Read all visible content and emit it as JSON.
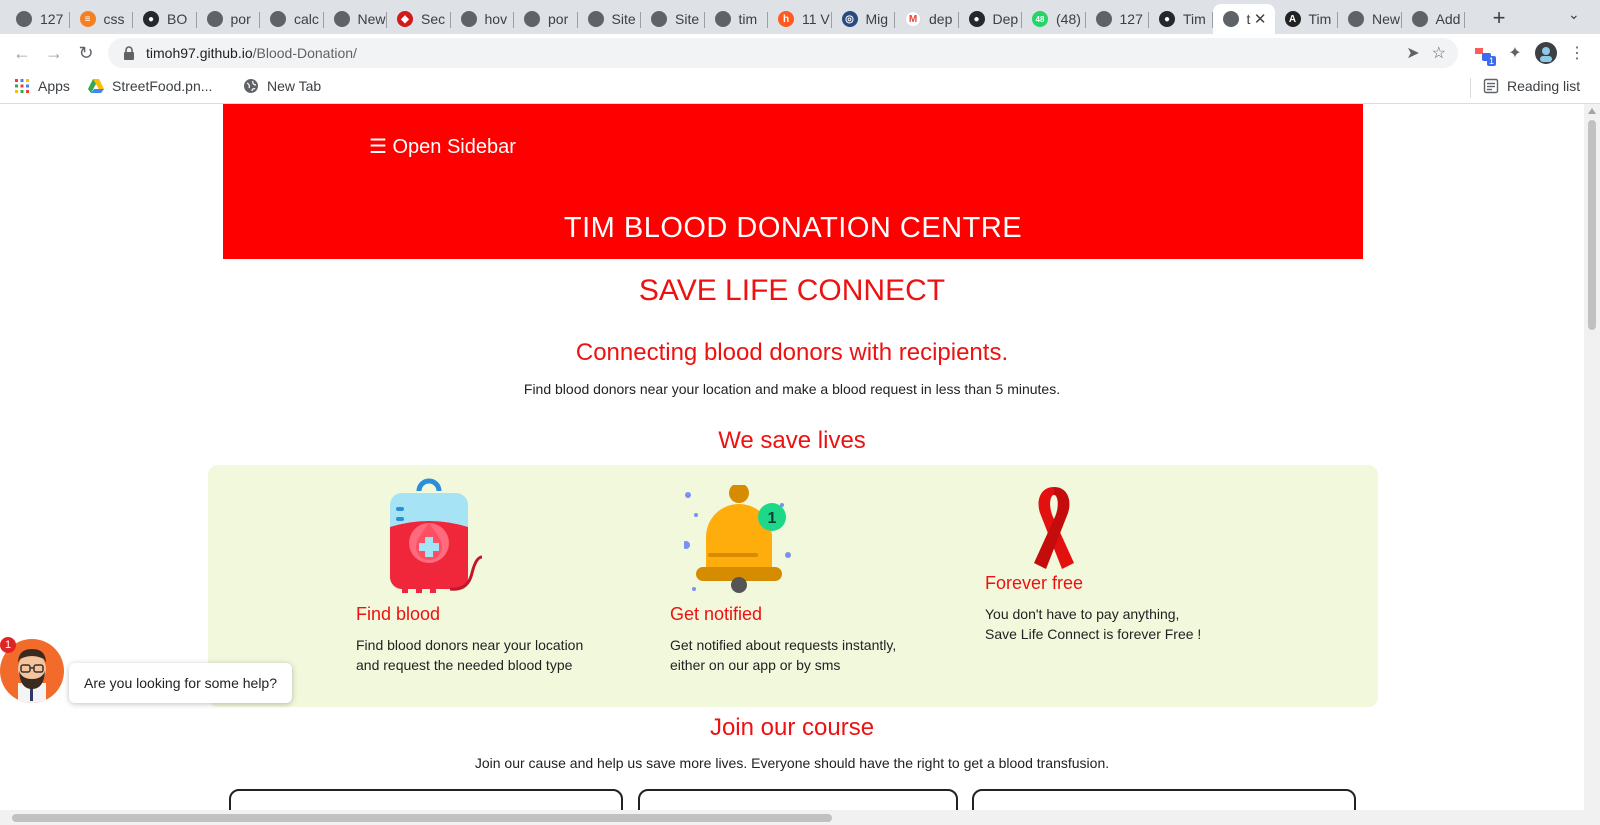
{
  "browser": {
    "tabs": [
      {
        "label": "127",
        "icon": "globe-icon"
      },
      {
        "label": "css",
        "icon": "stackoverflow-icon"
      },
      {
        "label": "BO",
        "icon": "github-icon"
      },
      {
        "label": "por",
        "icon": "globe-icon"
      },
      {
        "label": "calc",
        "icon": "globe-icon"
      },
      {
        "label": "New",
        "icon": "globe-icon"
      },
      {
        "label": "Sec",
        "icon": "red-diamond-icon"
      },
      {
        "label": "hov",
        "icon": "globe-icon"
      },
      {
        "label": "por",
        "icon": "globe-icon"
      },
      {
        "label": "Site",
        "icon": "globe-icon"
      },
      {
        "label": "Site",
        "icon": "globe-icon"
      },
      {
        "label": "tim",
        "icon": "globe-icon"
      },
      {
        "label": "11 V",
        "icon": "orange-box-icon"
      },
      {
        "label": "Mig",
        "icon": "circle-logo-icon"
      },
      {
        "label": "dep",
        "icon": "gmail-icon"
      },
      {
        "label": "Dep",
        "icon": "github-icon"
      },
      {
        "label": "(48)",
        "icon": "green-badge-icon"
      },
      {
        "label": "127",
        "icon": "globe-icon"
      },
      {
        "label": "Tim",
        "icon": "github-icon"
      },
      {
        "label": "t",
        "icon": "globe-icon",
        "active": true
      },
      {
        "label": "Tim",
        "icon": "angular-icon"
      },
      {
        "label": "New",
        "icon": "globe-icon"
      },
      {
        "label": "Add",
        "icon": "globe-icon"
      }
    ],
    "url_host": "timoh97.github.io",
    "url_path": "/Blood-Donation/",
    "bookmarks": {
      "apps": "Apps",
      "streetfood": "StreetFood.pn...",
      "newtab": "New Tab",
      "reading_list": "Reading list"
    },
    "extension_badge": "1"
  },
  "page": {
    "sidebar_button": "☰ Open Sidebar",
    "hero_title": "TIM BLOOD DONATION CENTRE",
    "main_heading": "SAVE LIFE CONNECT",
    "sub_heading": "Connecting blood donors with recipients.",
    "sub_text": "Find blood donors near your location and make a blood request in less than 5 minutes.",
    "lives_heading": "We save lives",
    "features": [
      {
        "title": "Find blood",
        "line1": "Find blood donors near your location",
        "line2": "and request the needed blood type"
      },
      {
        "title": "Get notified",
        "line1": "Get notified about requests instantly,",
        "line2": "either on our app or by sms"
      },
      {
        "title": "Forever free",
        "line1": "You don't have to pay anything,",
        "line2": "Save Life Connect is forever Free !"
      }
    ],
    "bell_badge": "1",
    "join_heading": "Join our course",
    "join_text": "Join our cause and help us save more lives. Everyone should have the right to get a blood transfusion."
  },
  "chat": {
    "badge": "1",
    "message": "Are you looking for some help?"
  },
  "colors": {
    "brand_red": "#ff0000",
    "heading_red": "#ee1111",
    "feature_bg": "#f1f8dc"
  }
}
